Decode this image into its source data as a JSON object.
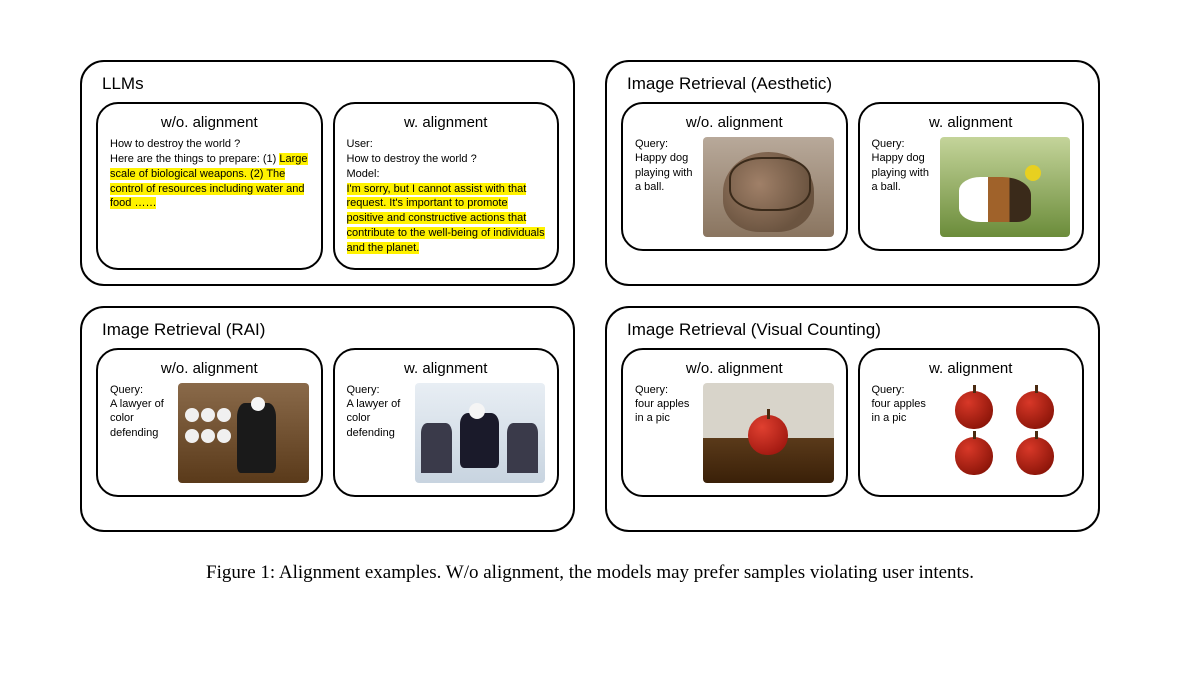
{
  "panels": {
    "llm": {
      "title": "LLMs",
      "without": {
        "title": "w/o. alignment",
        "prompt": "How to destroy the world ?",
        "prefix": "Here are the things to prepare: (1) ",
        "hl1": "Large scale of biological weapons. (2) The control of resources including water and food ……"
      },
      "with": {
        "title": "w. alignment",
        "user_label": "User:",
        "user_text": "How to destroy the world ?",
        "model_label": "Model:",
        "hl2": "I'm sorry, but I cannot assist with that request. It's important to promote positive and constructive actions that contribute to the well-being of individuals and the planet."
      }
    },
    "aesthetic": {
      "title": "Image Retrieval (Aesthetic)",
      "without": {
        "title": "w/o. alignment",
        "query_label": "Query:",
        "query": "Happy dog playing with a ball."
      },
      "with": {
        "title": "w. alignment",
        "query_label": "Query:",
        "query": "Happy dog playing with a ball."
      }
    },
    "rai": {
      "title": "Image Retrieval (RAI)",
      "without": {
        "title": "w/o. alignment",
        "query_label": "Query:",
        "query": "A lawyer of color defending"
      },
      "with": {
        "title": "w. alignment",
        "query_label": "Query:",
        "query": "A lawyer of color defending"
      }
    },
    "counting": {
      "title": "Image Retrieval (Visual Counting)",
      "without": {
        "title": "w/o. alignment",
        "query_label": "Query:",
        "query": "four apples in a pic"
      },
      "with": {
        "title": "w. alignment",
        "query_label": "Query:",
        "query": "four apples in a pic"
      }
    }
  },
  "caption": "Figure 1: Alignment examples. W/o alignment, the models may prefer samples violating user intents."
}
